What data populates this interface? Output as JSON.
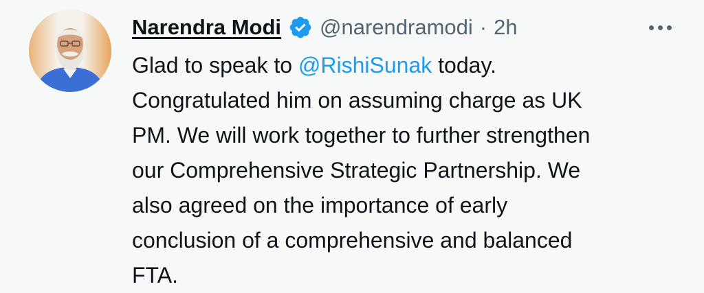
{
  "author": {
    "name": "Narendra Modi",
    "handle": "@narendramodi",
    "separator": "·",
    "time": "2h",
    "avatar_icon": "person-avatar",
    "verified_icon": "verified-badge-icon"
  },
  "tweet": {
    "line1_before": "Glad to speak to ",
    "mention": "@RishiSunak",
    "line1_after": " today.",
    "lines": [
      "Congratulated him on assuming charge as UK",
      "PM. We will work together to further strengthen",
      "our Comprehensive Strategic Partnership. We",
      "also agreed on the importance of early",
      "conclusion of a comprehensive and balanced",
      "FTA."
    ]
  },
  "menu": {
    "icon": "more-options-icon"
  },
  "colors": {
    "background": "#f7f9f9",
    "text": "#0f1419",
    "secondary": "#536471",
    "accent": "#1d9bf0"
  }
}
